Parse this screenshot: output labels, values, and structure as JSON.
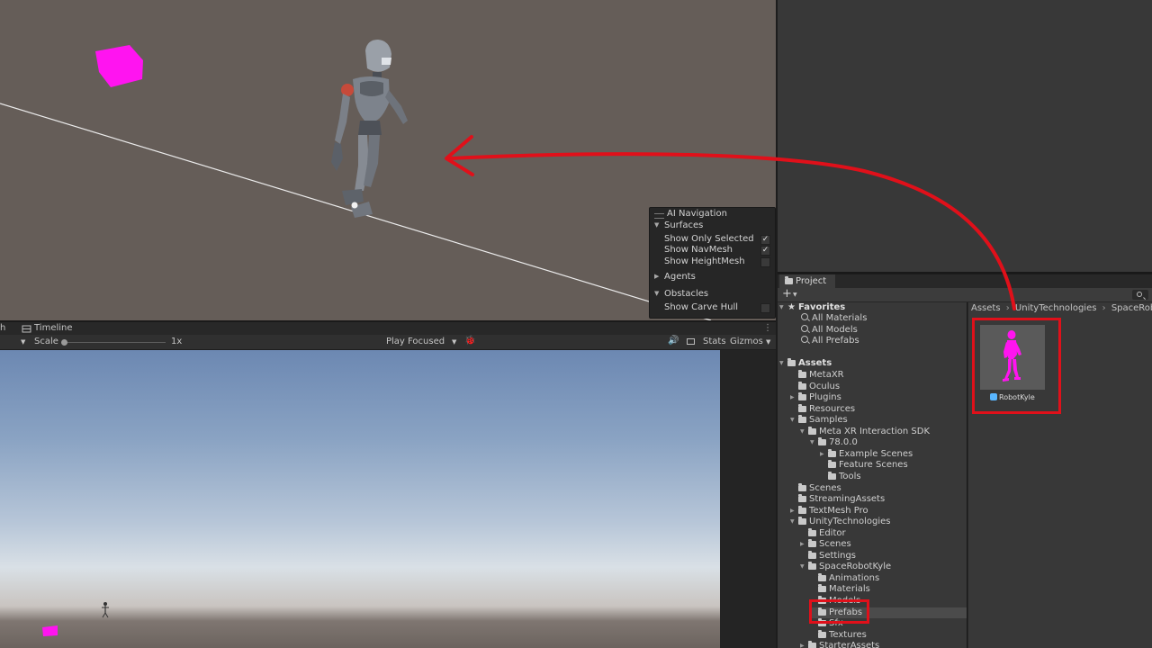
{
  "scene_view": {
    "ai_navigation": {
      "title": "AI Navigation",
      "surfaces_label": "Surfaces",
      "show_only_selected": {
        "label": "Show Only Selected",
        "checked": true
      },
      "show_navmesh": {
        "label": "Show NavMesh",
        "checked": true
      },
      "show_heightmesh": {
        "label": "Show HeightMesh",
        "checked": false
      },
      "agents_label": "Agents",
      "obstacles_label": "Obstacles",
      "show_carve_hull": {
        "label": "Show Carve Hull",
        "checked": false
      }
    }
  },
  "game_view": {
    "tab_fragment": "h",
    "timeline_tab": "Timeline",
    "scale_label": "Scale",
    "scale_value": "1x",
    "play_mode": "Play Focused",
    "stats_label": "Stats",
    "gizmos_label": "Gizmos"
  },
  "project": {
    "tab_label": "Project",
    "add_button": "+",
    "favorites": {
      "label": "Favorites",
      "items": [
        "All Materials",
        "All Models",
        "All Prefabs"
      ]
    },
    "assets_root": "Assets",
    "breadcrumb": [
      "Assets",
      "UnityTechnologies",
      "SpaceRobotK"
    ],
    "tree": [
      {
        "label": "MetaXR",
        "depth": 1,
        "arrow": ""
      },
      {
        "label": "Oculus",
        "depth": 1,
        "arrow": ""
      },
      {
        "label": "Plugins",
        "depth": 1,
        "arrow": "▶"
      },
      {
        "label": "Resources",
        "depth": 1,
        "arrow": ""
      },
      {
        "label": "Samples",
        "depth": 1,
        "arrow": "▼"
      },
      {
        "label": "Meta XR Interaction SDK",
        "depth": 2,
        "arrow": "▼"
      },
      {
        "label": "78.0.0",
        "depth": 3,
        "arrow": "▼"
      },
      {
        "label": "Example Scenes",
        "depth": 4,
        "arrow": "▶"
      },
      {
        "label": "Feature Scenes",
        "depth": 4,
        "arrow": ""
      },
      {
        "label": "Tools",
        "depth": 4,
        "arrow": ""
      },
      {
        "label": "Scenes",
        "depth": 1,
        "arrow": ""
      },
      {
        "label": "StreamingAssets",
        "depth": 1,
        "arrow": ""
      },
      {
        "label": "TextMesh Pro",
        "depth": 1,
        "arrow": "▶"
      },
      {
        "label": "UnityTechnologies",
        "depth": 1,
        "arrow": "▼"
      },
      {
        "label": "Editor",
        "depth": 2,
        "arrow": ""
      },
      {
        "label": "Scenes",
        "depth": 2,
        "arrow": "▶"
      },
      {
        "label": "Settings",
        "depth": 2,
        "arrow": ""
      },
      {
        "label": "SpaceRobotKyle",
        "depth": 2,
        "arrow": "▼"
      },
      {
        "label": "Animations",
        "depth": 3,
        "arrow": ""
      },
      {
        "label": "Materials",
        "depth": 3,
        "arrow": ""
      },
      {
        "label": "Models",
        "depth": 3,
        "arrow": ""
      },
      {
        "label": "Prefabs",
        "depth": 3,
        "arrow": "",
        "selected": true
      },
      {
        "label": "Sfx",
        "depth": 3,
        "arrow": ""
      },
      {
        "label": "Textures",
        "depth": 3,
        "arrow": ""
      },
      {
        "label": "StarterAssets",
        "depth": 2,
        "arrow": "▶"
      }
    ],
    "asset": {
      "name": "RobotKyle"
    }
  },
  "colors": {
    "annotation_red": "#e0101a",
    "scene_background": "#655d58",
    "missing_material": "#ff00ff",
    "editor_panel": "#383838"
  }
}
